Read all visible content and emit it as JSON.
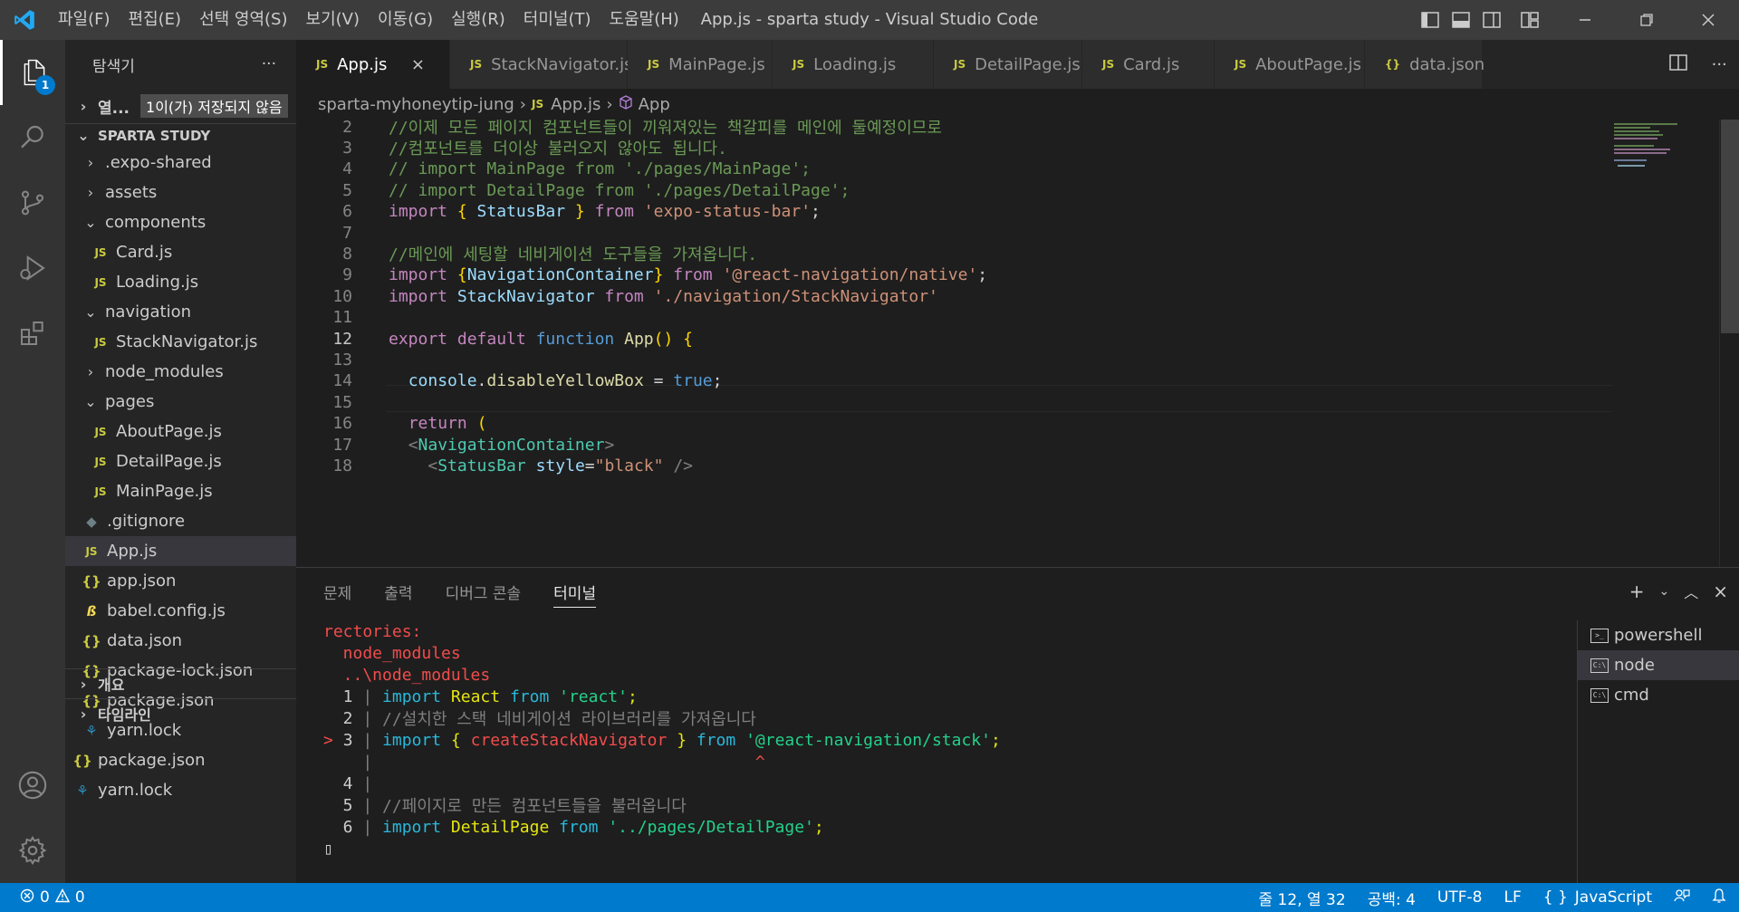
{
  "titlebar": {
    "menu": [
      "파일(F)",
      "편집(E)",
      "선택 영역(S)",
      "보기(V)",
      "이동(G)",
      "실행(R)",
      "터미널(T)",
      "도움말(H)"
    ],
    "title": "App.js - sparta study - Visual Studio Code"
  },
  "activity": {
    "explorer_badge": "1"
  },
  "sidebar": {
    "header": "탐색기",
    "more": "···",
    "open_editors_label": "열...",
    "unsaved_badge": "1이(가) 저장되지 않음",
    "project": "SPARTA STUDY",
    "tree": [
      {
        "label": ".expo-shared",
        "kind": "folder",
        "chev": "›",
        "indent": 1
      },
      {
        "label": "assets",
        "kind": "folder",
        "chev": "›",
        "indent": 1
      },
      {
        "label": "components",
        "kind": "folder",
        "chev": "⌄",
        "indent": 1
      },
      {
        "label": "Card.js",
        "kind": "js",
        "indent": 2
      },
      {
        "label": "Loading.js",
        "kind": "js",
        "indent": 2
      },
      {
        "label": "navigation",
        "kind": "folder",
        "chev": "⌄",
        "indent": 1
      },
      {
        "label": "StackNavigator.js",
        "kind": "js",
        "indent": 2
      },
      {
        "label": "node_modules",
        "kind": "folder",
        "chev": "›",
        "indent": 1
      },
      {
        "label": "pages",
        "kind": "folder",
        "chev": "⌄",
        "indent": 1
      },
      {
        "label": "AboutPage.js",
        "kind": "js",
        "indent": 2
      },
      {
        "label": "DetailPage.js",
        "kind": "js",
        "indent": 2
      },
      {
        "label": "MainPage.js",
        "kind": "js",
        "indent": 2
      },
      {
        "label": ".gitignore",
        "kind": "git",
        "indent": 1
      },
      {
        "label": "App.js",
        "kind": "js",
        "indent": 1,
        "selected": true
      },
      {
        "label": "app.json",
        "kind": "json",
        "indent": 1
      },
      {
        "label": "babel.config.js",
        "kind": "babel",
        "indent": 1
      },
      {
        "label": "data.json",
        "kind": "json",
        "indent": 1
      },
      {
        "label": "package-lock.json",
        "kind": "json",
        "indent": 1
      },
      {
        "label": "package.json",
        "kind": "json",
        "indent": 1
      },
      {
        "label": "yarn.lock",
        "kind": "yarn",
        "indent": 1
      },
      {
        "label": "package.json",
        "kind": "json",
        "indent": 0
      },
      {
        "label": "yarn.lock",
        "kind": "yarn",
        "indent": 0
      }
    ],
    "outline": "개요",
    "timeline": "타임라인"
  },
  "tabs": [
    {
      "label": "App.js",
      "active": true,
      "state": "close",
      "close_glyph": "×"
    },
    {
      "label": "StackNavigator.js"
    },
    {
      "label": "MainPage.js"
    },
    {
      "label": "Loading.js",
      "state": "dirty"
    },
    {
      "label": "DetailPage.js"
    },
    {
      "label": "Card.js"
    },
    {
      "label": "AboutPage.js"
    },
    {
      "label": "data.json",
      "json": true
    }
  ],
  "breadcrumb": {
    "folder": "sparta-myhoneytip-jung",
    "file": "App.js",
    "symbol": "App"
  },
  "editor": {
    "current_line": "12",
    "lines": [
      {
        "n": "2",
        "tokens": [
          [
            "cm",
            "//이제 모든 페이지 컴포넌트들이 끼워져있는 책갈피를 메인에 둘예정이므로"
          ]
        ]
      },
      {
        "n": "3",
        "tokens": [
          [
            "cm",
            "//컴포넌트를 더이상 불러오지 않아도 됩니다."
          ]
        ]
      },
      {
        "n": "4",
        "tokens": [
          [
            "cm",
            "// import MainPage from './pages/MainPage';"
          ]
        ]
      },
      {
        "n": "5",
        "tokens": [
          [
            "cm",
            "// import DetailPage from './pages/DetailPage';"
          ]
        ]
      },
      {
        "n": "6",
        "tokens": [
          [
            "kw",
            "import "
          ],
          [
            "br",
            "{ "
          ],
          [
            "vb",
            "StatusBar "
          ],
          [
            "br",
            "} "
          ],
          [
            "kw",
            "from "
          ],
          [
            "st",
            "'expo-status-bar'"
          ],
          [
            "pl",
            ";"
          ]
        ]
      },
      {
        "n": "7",
        "tokens": []
      },
      {
        "n": "8",
        "tokens": [
          [
            "cm",
            "//메인에 세팅할 네비게이션 도구들을 가져옵니다."
          ]
        ]
      },
      {
        "n": "9",
        "tokens": [
          [
            "kw",
            "import "
          ],
          [
            "br",
            "{"
          ],
          [
            "vb",
            "NavigationContainer"
          ],
          [
            "br",
            "} "
          ],
          [
            "kw",
            "from "
          ],
          [
            "st",
            "'@react-navigation/native'"
          ],
          [
            "pl",
            ";"
          ]
        ]
      },
      {
        "n": "10",
        "tokens": [
          [
            "kw",
            "import "
          ],
          [
            "vb",
            "StackNavigator "
          ],
          [
            "kw",
            "from "
          ],
          [
            "st",
            "'./navigation/StackNavigator'"
          ]
        ]
      },
      {
        "n": "11",
        "tokens": []
      },
      {
        "n": "12",
        "tokens": [
          [
            "kw",
            "export default "
          ],
          [
            "kb",
            "function "
          ],
          [
            "fn",
            "App"
          ],
          [
            "br",
            "() "
          ],
          [
            "br",
            "{"
          ]
        ]
      },
      {
        "n": "13",
        "tokens": []
      },
      {
        "n": "14",
        "tokens": [
          [
            "pl",
            "  "
          ],
          [
            "vb",
            "console"
          ],
          [
            "pl",
            "."
          ],
          [
            "fn",
            "disableYellowBox"
          ],
          [
            "pl",
            " = "
          ],
          [
            "kb",
            "true"
          ],
          [
            "pl",
            ";"
          ]
        ]
      },
      {
        "n": "15",
        "tokens": []
      },
      {
        "n": "16",
        "tokens": [
          [
            "pl",
            "  "
          ],
          [
            "kw",
            "return"
          ],
          [
            "pl",
            " "
          ],
          [
            "br",
            "("
          ]
        ]
      },
      {
        "n": "17",
        "tokens": [
          [
            "pl",
            "  "
          ],
          [
            "dim",
            "<"
          ],
          [
            "tg",
            "NavigationContainer"
          ],
          [
            "dim",
            ">"
          ]
        ]
      },
      {
        "n": "18",
        "tokens": [
          [
            "pl",
            "    "
          ],
          [
            "dim",
            "<"
          ],
          [
            "tg",
            "StatusBar"
          ],
          [
            "pl",
            " "
          ],
          [
            "vb",
            "style"
          ],
          [
            "pl",
            "="
          ],
          [
            "st",
            "\"black\""
          ],
          [
            "pl",
            " "
          ],
          [
            "dim",
            "/>"
          ]
        ]
      }
    ]
  },
  "panel": {
    "tabs": [
      "문제",
      "출력",
      "디버그 콘솔",
      "터미널"
    ],
    "active_tab": "터미널",
    "terminal_lines": [
      [
        [
          "t-red",
          "rectories:"
        ]
      ],
      [
        [
          "t-red",
          "  node_modules"
        ]
      ],
      [
        [
          "t-red",
          "  ..\\node_modules"
        ]
      ],
      [
        [
          "t-gray",
          "  1 "
        ],
        [
          "t-dim",
          "| "
        ],
        [
          "t-cyan",
          "import "
        ],
        [
          "t-yellow",
          "React "
        ],
        [
          "t-cyan",
          "from "
        ],
        [
          "t-green",
          "'react'"
        ],
        [
          "t-yellow",
          ";"
        ]
      ],
      [
        [
          "t-gray",
          "  2 "
        ],
        [
          "t-dim",
          "| "
        ],
        [
          "t-dim",
          "//설치한 스택 네비게이션 라이브러리를 가져옵니다"
        ]
      ],
      [
        [
          "t-red",
          "> "
        ],
        [
          "t-gray",
          "3 "
        ],
        [
          "t-dim",
          "| "
        ],
        [
          "t-cyan",
          "import "
        ],
        [
          "t-yellow",
          "{ "
        ],
        [
          "t-red",
          "createStackNavigator "
        ],
        [
          "t-yellow",
          "} "
        ],
        [
          "t-cyan",
          "from "
        ],
        [
          "t-green",
          "'@react-navigation/stack'"
        ],
        [
          "t-yellow",
          ";"
        ]
      ],
      [
        [
          "t-gray",
          "    "
        ],
        [
          "t-dim",
          "| "
        ],
        [
          "t-red",
          "                                      ^"
        ]
      ],
      [
        [
          "t-gray",
          "  4 "
        ],
        [
          "t-dim",
          "|"
        ]
      ],
      [
        [
          "t-gray",
          "  5 "
        ],
        [
          "t-dim",
          "| "
        ],
        [
          "t-dim",
          "//페이지로 만든 컴포넌트들을 불러옵니다"
        ]
      ],
      [
        [
          "t-gray",
          "  6 "
        ],
        [
          "t-dim",
          "| "
        ],
        [
          "t-cyan",
          "import "
        ],
        [
          "t-yellow",
          "DetailPage "
        ],
        [
          "t-cyan",
          "from "
        ],
        [
          "t-green",
          "'../pages/DetailPage'"
        ],
        [
          "t-yellow",
          ";"
        ]
      ],
      [
        [
          "t-gray",
          "▯"
        ]
      ]
    ],
    "terminals": [
      {
        "label": "powershell",
        "icon": ">_"
      },
      {
        "label": "node",
        "icon": "C:\\",
        "active": true
      },
      {
        "label": "cmd",
        "icon": "C:\\"
      }
    ]
  },
  "statusbar": {
    "errors": "0",
    "warnings": "0",
    "position": "줄 12, 열 32",
    "spaces": "공백: 4",
    "encoding": "UTF-8",
    "eol": "LF",
    "language": "JavaScript"
  },
  "colors": {
    "accent": "#007acc",
    "titlebar": "#3c3c3c",
    "editor_bg": "#1e1e1e",
    "sidebar_bg": "#252526"
  }
}
